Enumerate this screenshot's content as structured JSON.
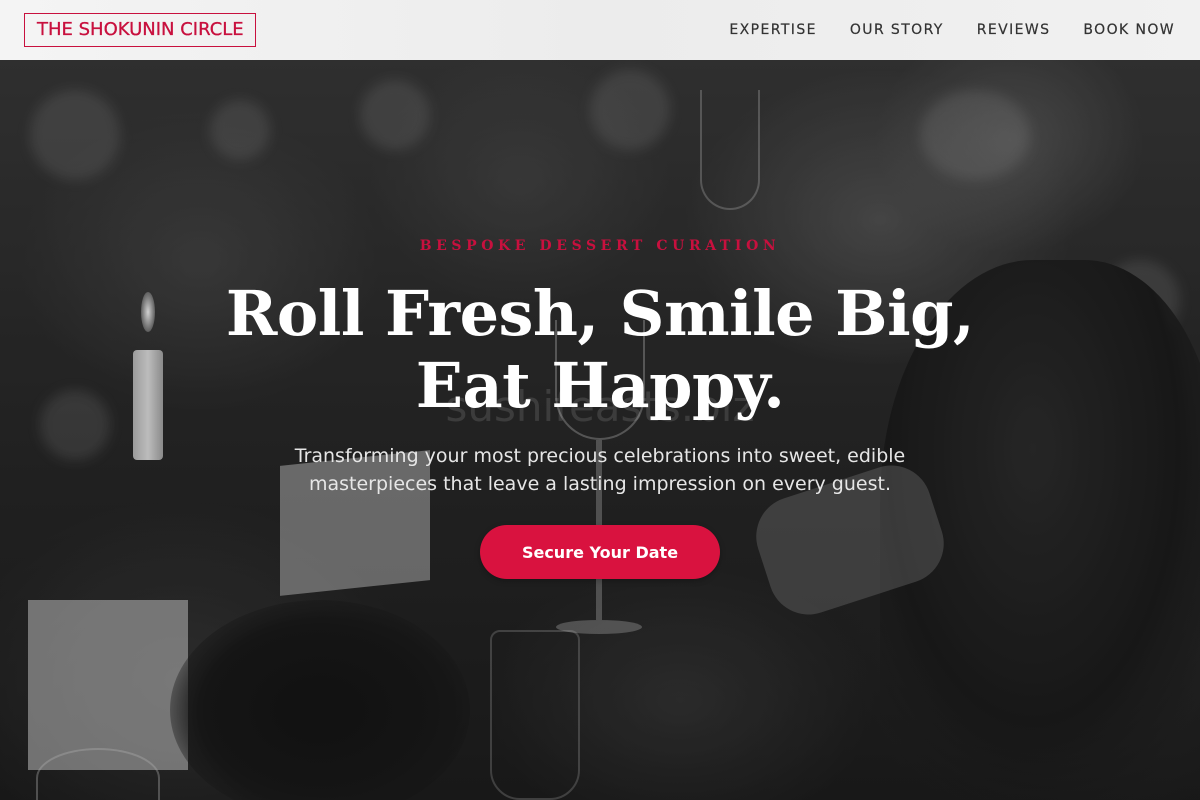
{
  "header": {
    "logo": "THE SHOKUNIN CIRCLE",
    "nav": [
      {
        "label": "EXPERTISE"
      },
      {
        "label": "OUR STORY"
      },
      {
        "label": "REVIEWS"
      },
      {
        "label": "BOOK NOW"
      }
    ]
  },
  "hero": {
    "eyebrow": "BESPOKE DESSERT CURATION",
    "headline_line1": "Roll Fresh, Smile Big,",
    "headline_line2": "Eat Happy.",
    "subhead_line1": "Transforming your most precious celebrations into sweet, edible",
    "subhead_line2": "masterpieces that leave a lasting impression on every guest.",
    "cta_label": "Secure Your Date",
    "watermark": "sushifeasts.biz",
    "background_description_icon": "celebration-photo-background"
  },
  "colors": {
    "accent": "#c8103e",
    "cta": "#d9123f",
    "header_bg": "#f0f0f0",
    "headline": "#ffffff"
  }
}
